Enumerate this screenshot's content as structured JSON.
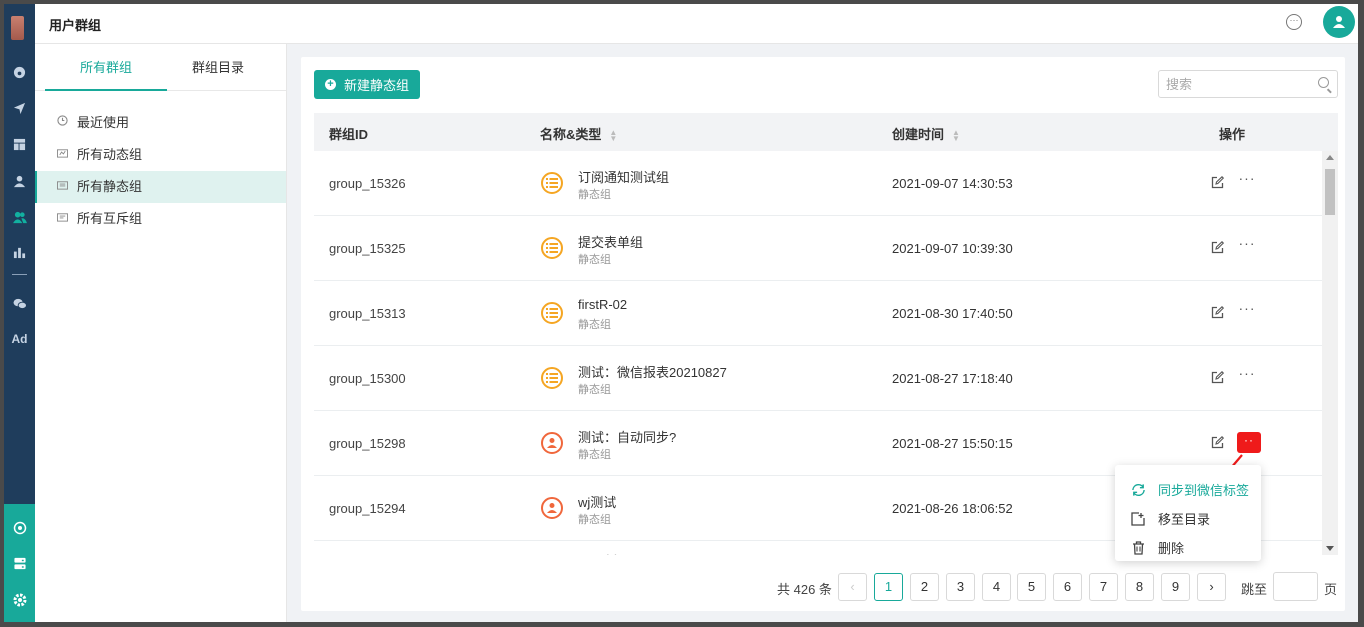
{
  "header": {
    "title": "用户群组"
  },
  "sidenav": {
    "tabs": [
      "所有群组",
      "群组目录"
    ],
    "items": [
      "最近使用",
      "所有动态组",
      "所有静态组",
      "所有互斥组"
    ]
  },
  "toolbar": {
    "new_label": "新建静态组",
    "search_placeholder": "搜索"
  },
  "table": {
    "columns": [
      "群组ID",
      "名称&类型",
      "创建时间",
      "操作"
    ],
    "rows": [
      {
        "id": "group_15326",
        "name": "订阅通知测试组",
        "kind": "静态组",
        "time": "2021-09-07 14:30:53",
        "icon": "list-icon"
      },
      {
        "id": "group_15325",
        "name": "提交表单组",
        "kind": "静态组",
        "time": "2021-09-07 10:39:30",
        "icon": "list-icon"
      },
      {
        "id": "group_15313",
        "name": "firstR-02",
        "kind": "静态组",
        "time": "2021-08-30 17:40:50",
        "icon": "list-icon"
      },
      {
        "id": "group_15300",
        "name": "测试：微信报表20210827",
        "kind": "静态组",
        "time": "2021-08-27 17:18:40",
        "icon": "list-icon"
      },
      {
        "id": "group_15298",
        "name": "测试：自动同步?",
        "kind": "静态组",
        "time": "2021-08-27 15:50:15",
        "icon": "user-icon"
      },
      {
        "id": "group_15294",
        "name": "wj测试",
        "kind": "静态组",
        "time": "2021-08-26 18:06:52",
        "icon": "user-icon"
      }
    ],
    "partial_row_text": "...∴∴..."
  },
  "menu": {
    "items": [
      "同步到微信标签",
      "移至目录",
      "删除"
    ]
  },
  "pagination": {
    "total": "共 426 条",
    "pages": [
      "1",
      "2",
      "3",
      "4",
      "5",
      "6",
      "7",
      "8",
      "9"
    ],
    "current": "1",
    "jump_label": "跳至",
    "page_suffix": "页"
  },
  "colors": {
    "accent": "#18a99a",
    "rail": "#1f3d5c",
    "highlight": "#ef1a1a",
    "list_icon": "#f5a623",
    "user_icon": "#f0673c"
  }
}
